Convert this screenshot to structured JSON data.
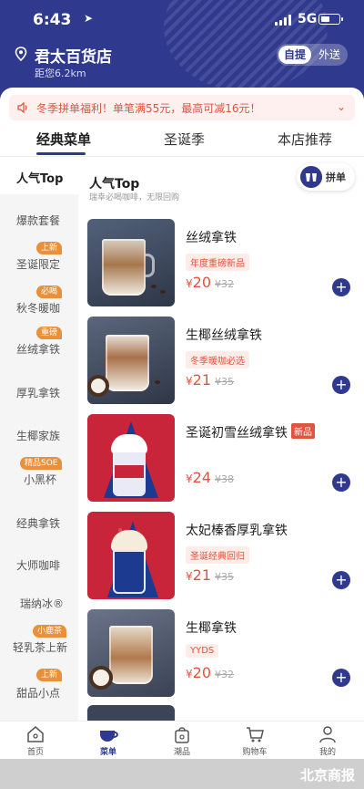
{
  "status_bar": {
    "time": "6:43",
    "network": "5G"
  },
  "store": {
    "name": "君太百货店",
    "distance": "距您6.2km"
  },
  "mode_toggle": {
    "selected": "自提",
    "other": "外送"
  },
  "notice": {
    "text": "冬季拼单福利！单笔满55元，最高可减16元！"
  },
  "tabs": [
    "经典菜单",
    "圣诞季",
    "本店推荐"
  ],
  "sidebar": {
    "items": [
      {
        "label": "人气Top",
        "badge": ""
      },
      {
        "label": "爆款套餐",
        "badge": ""
      },
      {
        "label": "圣诞限定",
        "badge": "上新"
      },
      {
        "label": "秋冬暖咖",
        "badge": "必喝"
      },
      {
        "label": "丝绒拿铁",
        "badge": "重磅"
      },
      {
        "label": "厚乳拿铁",
        "badge": ""
      },
      {
        "label": "生椰家族",
        "badge": ""
      },
      {
        "label": "小黑杯",
        "badge": "精品SOE"
      },
      {
        "label": "经典拿铁",
        "badge": ""
      },
      {
        "label": "大师咖啡",
        "badge": ""
      },
      {
        "label": "瑞纳冰®",
        "badge": ""
      },
      {
        "label": "轻乳茶上新",
        "badge": "小鹿茶"
      },
      {
        "label": "甜品小点",
        "badge": "上新"
      }
    ]
  },
  "section": {
    "title": "人气Top",
    "subtitle": "瑞幸必喝咖啡，无限回购"
  },
  "group_order": {
    "label": "拼单"
  },
  "products": [
    {
      "name": "丝绒拿铁",
      "badge": "",
      "tag": "年度重磅新品",
      "price": "20",
      "original": "¥32"
    },
    {
      "name": "生椰丝绒拿铁",
      "badge": "",
      "tag": "冬季暖咖必选",
      "price": "21",
      "original": "¥35"
    },
    {
      "name": "圣诞初雪丝绒拿铁",
      "badge": "新品",
      "tag": "",
      "price": "24",
      "original": "¥38"
    },
    {
      "name": "太妃榛香厚乳拿铁",
      "badge": "",
      "tag": "圣诞经典回归",
      "price": "21",
      "original": "¥35"
    },
    {
      "name": "生椰拿铁",
      "badge": "",
      "tag": "YYDS",
      "price": "20",
      "original": "¥32"
    }
  ],
  "currency": "¥",
  "bottom_nav": [
    "首页",
    "菜单",
    "潮品",
    "购物车",
    "我的"
  ],
  "watermark": "北京商报",
  "colors": {
    "brand": "#2f3a8f",
    "accent": "#e0533f",
    "badge": "#e8913a"
  }
}
